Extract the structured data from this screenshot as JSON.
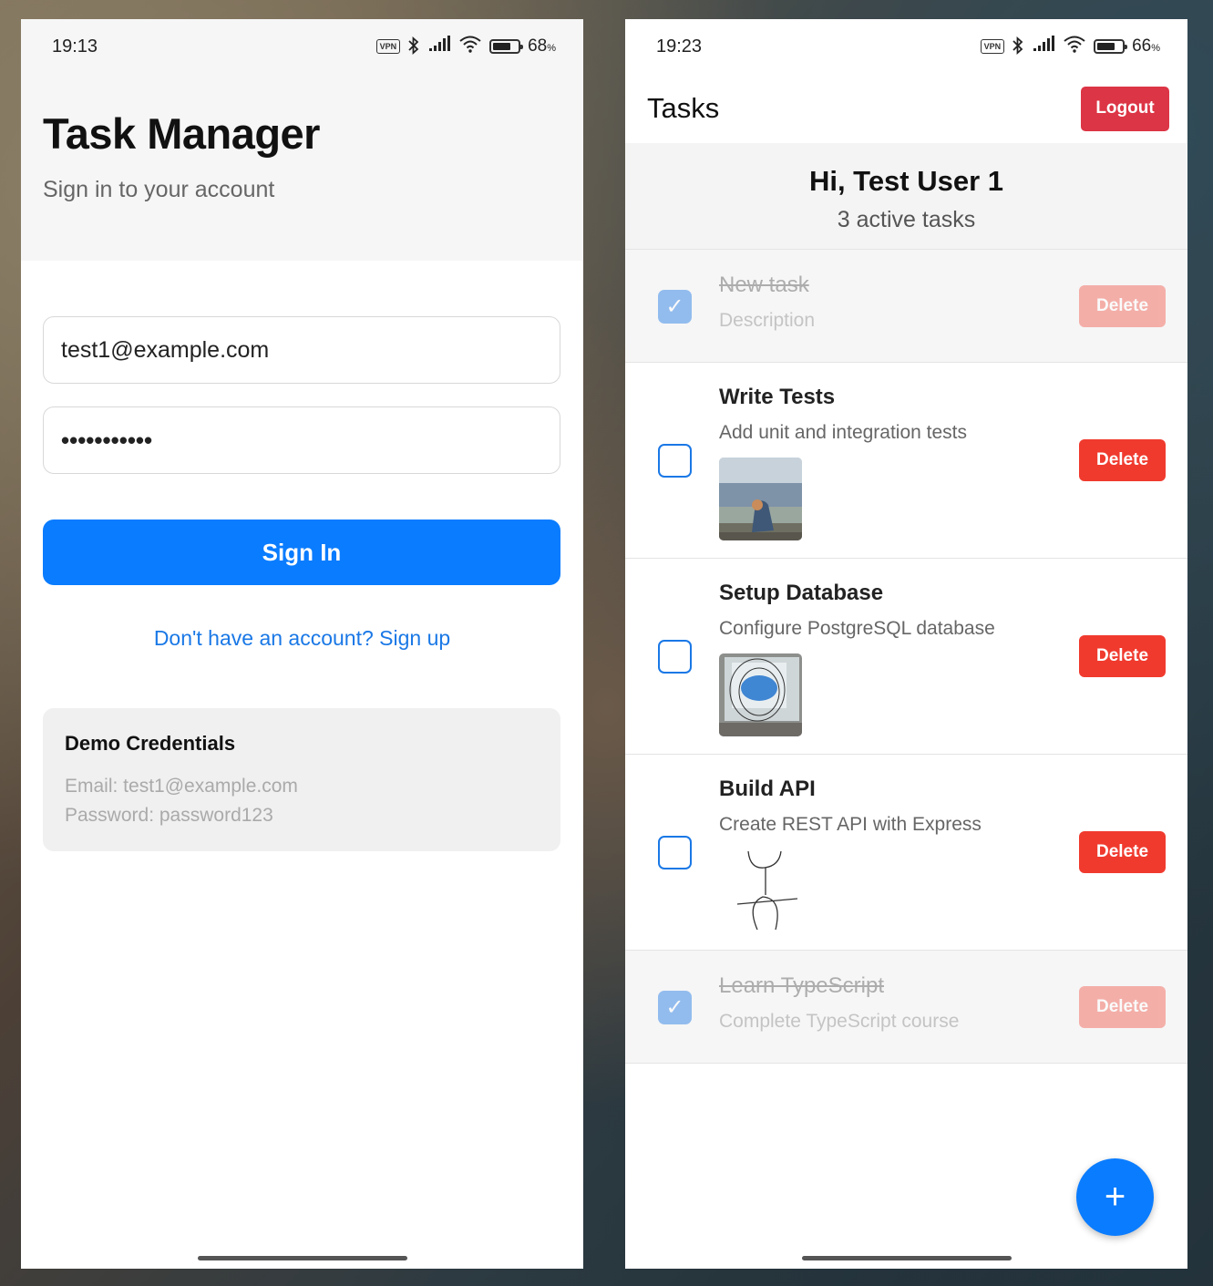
{
  "login_screen": {
    "status_bar": {
      "time": "19:13",
      "vpn": "VPN",
      "battery_pct": "68",
      "battery_unit": "%"
    },
    "title": "Task Manager",
    "subtitle": "Sign in to your account",
    "email_value": "test1@example.com",
    "password_masked": "•••••••••••",
    "sign_in_label": "Sign In",
    "signup_link": "Don't have an account? Sign up",
    "demo": {
      "title": "Demo Credentials",
      "email_line": "Email: test1@example.com",
      "password_line": "Password: password123"
    }
  },
  "tasks_screen": {
    "status_bar": {
      "time": "19:23",
      "vpn": "VPN",
      "battery_pct": "66",
      "battery_unit": "%"
    },
    "title": "Tasks",
    "logout_label": "Logout",
    "greeting": "Hi, Test User 1",
    "active_count": "3 active tasks",
    "fab_icon": "plus-icon",
    "fab_symbol": "+",
    "tasks": [
      {
        "title": "New task",
        "description": "Description",
        "completed": true,
        "delete_label": "Delete",
        "check": "✓"
      },
      {
        "title": "Write Tests",
        "description": "Add unit and integration tests",
        "completed": false,
        "delete_label": "Delete",
        "image": "painting of a seated figure by the sea"
      },
      {
        "title": "Setup Database",
        "description": "Configure PostgreSQL database",
        "completed": false,
        "delete_label": "Delete",
        "image": "photo of a screen with blue circle sketch"
      },
      {
        "title": "Build API",
        "description": "Create REST API with Express",
        "completed": false,
        "delete_label": "Delete",
        "image": "hand-drawn stick figure sketch"
      },
      {
        "title": "Learn TypeScript",
        "description": "Complete TypeScript course",
        "completed": true,
        "delete_label": "Delete",
        "check": "✓"
      }
    ]
  },
  "colors": {
    "primary": "#0a7cff",
    "danger": "#f03a2e",
    "logout": "#dc3545"
  }
}
